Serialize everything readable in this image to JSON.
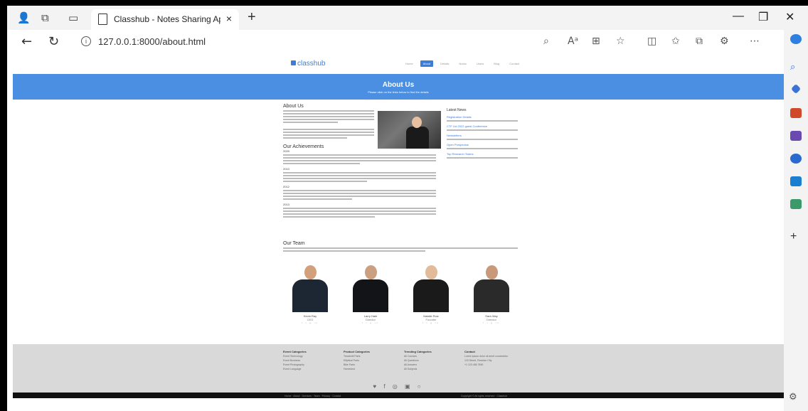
{
  "browser": {
    "tab_title": "Classhub - Notes Sharing Applic",
    "url": "127.0.0.1:8000/about.html",
    "tab_close": "×",
    "new_tab": "+"
  },
  "site": {
    "logo": "classhub",
    "menu": [
      "Home",
      "About",
      "Details",
      "Notes",
      "Users",
      "Blog",
      "Contact"
    ],
    "banner_title": "About Us",
    "banner_subtitle": "Please click on the links below to find the details"
  },
  "about": {
    "heading": "About Us",
    "achievements_heading": "Our Achievements",
    "years": [
      "2009",
      "2010",
      "2012",
      "2013"
    ],
    "latest_heading": "Latest News",
    "latest_links": [
      "Registration Details",
      "CTF Ltd 2022 guest Conference",
      "Newsletters",
      "Open Prospectus",
      "Top Research Teams"
    ]
  },
  "team": {
    "heading": "Our Team",
    "members": [
      {
        "name": "Kevin Ray",
        "role": "CEO",
        "head": "#d2a07a",
        "torso": "#1d2733"
      },
      {
        "name": "Larry Hale",
        "role": "Director",
        "head": "#caa080",
        "torso": "#121418"
      },
      {
        "name": "Natalie Ruiz",
        "role": "Founder",
        "head": "#e2bb9a",
        "torso": "#1a1a1a"
      },
      {
        "name": "Sara Way",
        "role": "Director",
        "head": "#c99a7a",
        "torso": "#2a2a2a"
      }
    ],
    "social": "f  t  g  in"
  },
  "footer": {
    "columns": [
      {
        "heading": "Event Categories",
        "items": [
          "Event Technology",
          "Event Business",
          "Event Photography",
          "Event Language"
        ]
      },
      {
        "heading": "Product Categories",
        "items": [
          "Treadmill Parts",
          "Elliptical Parts",
          "Bike Parts",
          "Homeland"
        ]
      },
      {
        "heading": "Trending Categories",
        "items": [
          "All Courses",
          "All Questions",
          "All Answers",
          "All Subjects"
        ]
      },
      {
        "heading": "Contact",
        "items": [
          "Lorem ipsum dolor sit amet consectetur",
          "123 Street, Random City",
          "+1 123 456 7890"
        ]
      }
    ],
    "social": "♥ f ◎ ▣ ○",
    "bottom_left": "Home · About · Services · Team · Privacy · Contact",
    "bottom_right": "Copyright © All rights reserved · Classhub"
  }
}
